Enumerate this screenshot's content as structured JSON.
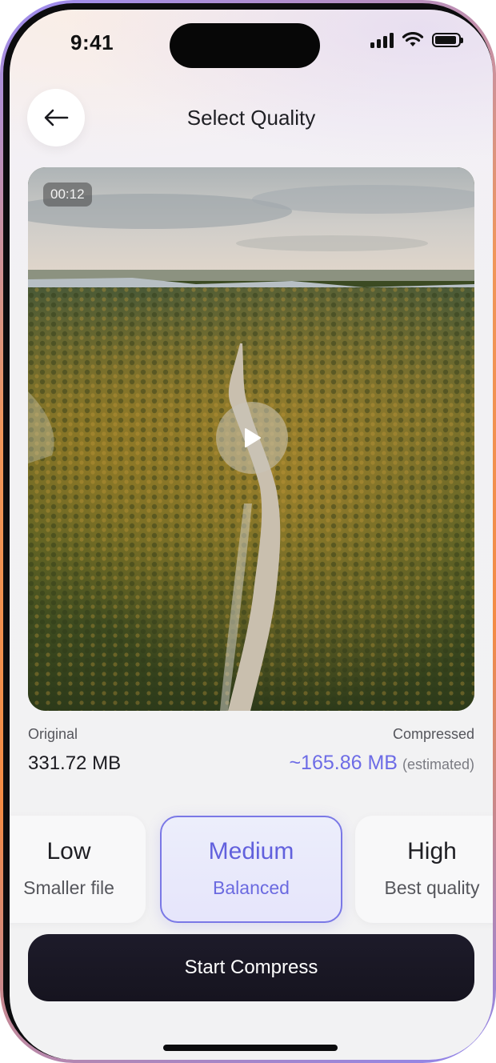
{
  "status_bar": {
    "time": "9:41"
  },
  "header": {
    "title": "Select Quality"
  },
  "icons": {
    "back": "arrow-left-icon",
    "play": "play-icon",
    "signal": "signal-icon",
    "wifi": "wifi-icon",
    "battery": "battery-icon"
  },
  "video": {
    "duration": "00:12"
  },
  "sizes": {
    "original_label": "Original",
    "original_value": "331.72 MB",
    "compressed_label": "Compressed",
    "compressed_value": "~165.86 MB",
    "compressed_note": "(estimated)"
  },
  "quality_options": [
    {
      "name": "Low",
      "description": "Smaller file",
      "selected": false
    },
    {
      "name": "Medium",
      "description": "Balanced",
      "selected": true
    },
    {
      "name": "High",
      "description": "Best quality",
      "selected": false
    }
  ],
  "actions": {
    "start_label": "Start Compress"
  },
  "colors": {
    "accent": "#6d6ce6",
    "button_dark": "#1a1826",
    "frame_orange": "#f38b45",
    "frame_purple": "#9c8cf2"
  }
}
